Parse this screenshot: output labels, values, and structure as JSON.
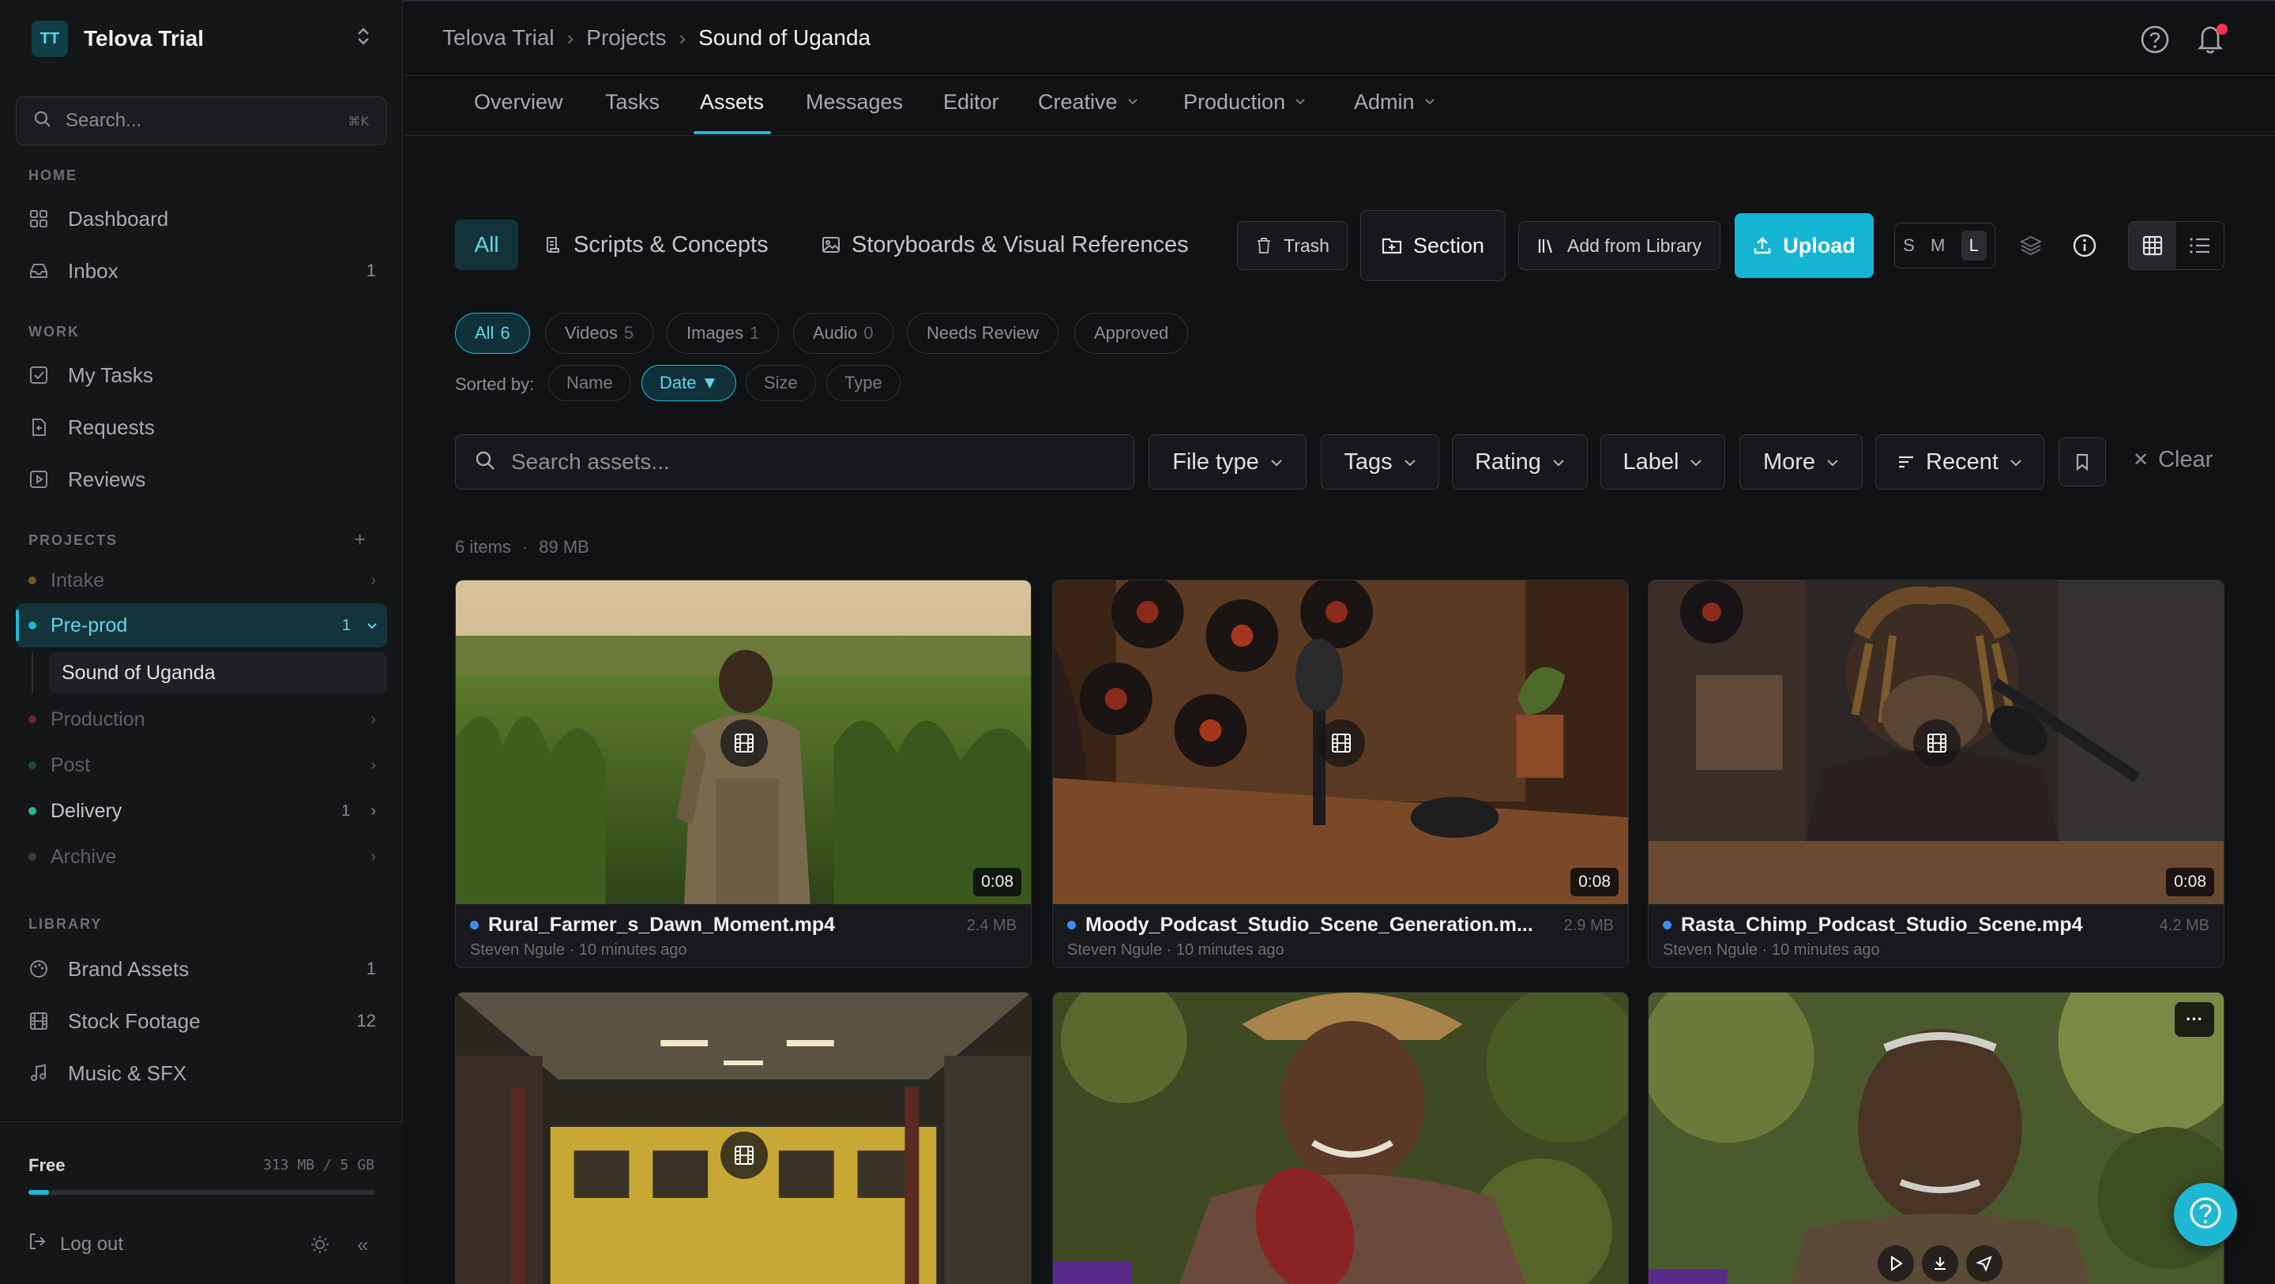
{
  "workspace": {
    "initials": "TT",
    "name": "Telova Trial"
  },
  "sidebar": {
    "search_placeholder": "Search...",
    "search_shortcut": "⌘K",
    "sections": {
      "home": "HOME",
      "work": "WORK",
      "projects": "PROJECTS",
      "library": "LIBRARY"
    },
    "home_items": [
      {
        "label": "Dashboard",
        "count": ""
      },
      {
        "label": "Inbox",
        "count": "1"
      }
    ],
    "work_items": [
      {
        "label": "My Tasks"
      },
      {
        "label": "Requests"
      },
      {
        "label": "Reviews"
      }
    ],
    "projects": [
      {
        "label": "Intake",
        "count": "",
        "color": "#7a5a1a"
      },
      {
        "label": "Pre-prod",
        "count": "1",
        "color": "#1fb8d4"
      },
      {
        "label": "Production",
        "count": "",
        "color": "#6a2a2a"
      },
      {
        "label": "Post",
        "count": "",
        "color": "#1e4a3a"
      },
      {
        "label": "Delivery",
        "count": "1",
        "color": "#1fb89a"
      },
      {
        "label": "Archive",
        "count": "",
        "color": "#3a3c40"
      }
    ],
    "active_subproject": "Sound of Uganda",
    "library_items": [
      {
        "label": "Brand Assets",
        "count": "1"
      },
      {
        "label": "Stock Footage",
        "count": "12"
      },
      {
        "label": "Music & SFX",
        "count": ""
      }
    ],
    "plan": "Free",
    "quota": "313 MB / 5 GB",
    "quota_fraction": 0.06,
    "logout": "Log out"
  },
  "breadcrumb": [
    "Telova Trial",
    "Projects",
    "Sound of Uganda"
  ],
  "tabs": [
    {
      "label": "Overview"
    },
    {
      "label": "Tasks"
    },
    {
      "label": "Assets",
      "active": true
    },
    {
      "label": "Messages"
    },
    {
      "label": "Editor"
    },
    {
      "label": "Creative",
      "dropdown": true
    },
    {
      "label": "Production",
      "dropdown": true
    },
    {
      "label": "Admin",
      "dropdown": true
    }
  ],
  "toolbar": {
    "segments": [
      "All",
      "Scripts & Concepts",
      "Storyboards & Visual References"
    ],
    "trash": "Trash",
    "section": "Section",
    "add_from_library": "Add from Library",
    "upload": "Upload",
    "sizes": [
      "S",
      "M",
      "L"
    ],
    "active_size": "L"
  },
  "filters": [
    {
      "label": "All",
      "count": "6",
      "active": true
    },
    {
      "label": "Videos",
      "count": "5"
    },
    {
      "label": "Images",
      "count": "1"
    },
    {
      "label": "Audio",
      "count": "0"
    },
    {
      "label": "Needs Review",
      "count": ""
    },
    {
      "label": "Approved",
      "count": ""
    }
  ],
  "sort": {
    "label": "Sorted by:",
    "options": [
      "Name",
      "Date ▼",
      "Size",
      "Type"
    ],
    "active": "Date ▼"
  },
  "asset_search_placeholder": "Search assets...",
  "filter_buttons": [
    "File type",
    "Tags",
    "Rating",
    "Label",
    "More",
    "Recent"
  ],
  "clear_label": "Clear",
  "summary": {
    "items": "6 items",
    "size": "89 MB"
  },
  "assets": [
    {
      "name": "Rural_Farmer_s_Dawn_Moment.mp4",
      "size": "2.4 MB",
      "author": "Steven Ngule",
      "time": "10 minutes ago",
      "duration": "0:08"
    },
    {
      "name": "Moody_Podcast_Studio_Scene_Generation.m...",
      "size": "2.9 MB",
      "author": "Steven Ngule",
      "time": "10 minutes ago",
      "duration": "0:08"
    },
    {
      "name": "Rasta_Chimp_Podcast_Studio_Scene.mp4",
      "size": "4.2 MB",
      "author": "Steven Ngule",
      "time": "10 minutes ago",
      "duration": "0:08"
    }
  ],
  "colors": {
    "accent": "#1fb8d4",
    "notification": "#f2334a",
    "status_dot": "#3d8df0"
  }
}
